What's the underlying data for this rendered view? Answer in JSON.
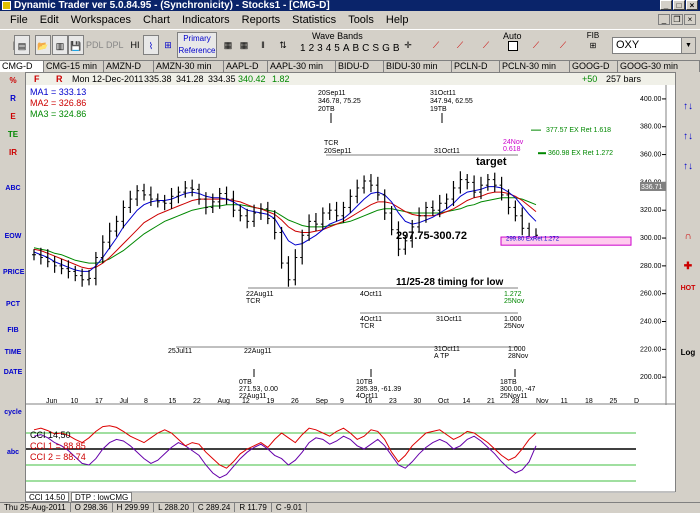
{
  "window": {
    "title": "Dynamic Trader ver 5.0.84.95 - (Synchronicity) - Stocks1 - [CMG-D]",
    "controls": [
      "_",
      "□",
      "×"
    ]
  },
  "menu": [
    "File",
    "Edit",
    "Workspaces",
    "Chart",
    "Indicators",
    "Reports",
    "Statistics",
    "Tools",
    "Help"
  ],
  "toolbar": {
    "buttons": [
      "PDL",
      "DPL",
      "HI"
    ],
    "primary_reference": [
      "Primary",
      "Reference"
    ],
    "wave_bands_label": "Wave Bands",
    "wave_bands": [
      "1",
      "2",
      "3",
      "4",
      "5",
      "A",
      "B",
      "C",
      "S",
      "G",
      "B"
    ],
    "auto_label": "Auto",
    "fib_label": "FIB",
    "symbol": "OXY"
  },
  "tabs": [
    "CMG-D",
    "CMG-15 min",
    "AMZN-D",
    "AMZN-30 min",
    "AAPL-D",
    "AAPL-30 min",
    "BIDU-D",
    "BIDU-30 min",
    "PCLN-D",
    "PCLN-30 min",
    "GOOG-D",
    "GOOG-30 min"
  ],
  "infobar": {
    "f": "F",
    "r": "R",
    "date": "Mon 12-Dec-2011",
    "open": "335.38",
    "high": "341.28",
    "low": "334.35",
    "close": "340.42",
    "change": "1.82",
    "bars_change": "+50",
    "bars": "257 bars"
  },
  "moving_averages": [
    {
      "label": "MA1 = 333.13",
      "color": "#0000cc"
    },
    {
      "label": "MA2 = 326.86",
      "color": "#cc0000"
    },
    {
      "label": "MA3 = 324.86",
      "color": "#008800"
    }
  ],
  "cci": [
    {
      "label": "CCI 14,50",
      "color": "#000000"
    },
    {
      "label": "CCI 1 = 88.85",
      "color": "#cc0000"
    },
    {
      "label": "CCI 2 = 88.74",
      "color": "#cc0000"
    }
  ],
  "chart_data": {
    "type": "line",
    "series_type": "ohlc-bars",
    "ylim": [
      180,
      410
    ],
    "yticks": [
      200,
      220,
      240,
      260,
      280,
      300,
      320,
      340,
      360,
      380,
      400
    ],
    "xticks": [
      "Jun",
      "10",
      "17",
      "Jul",
      "8",
      "15",
      "22",
      "Aug",
      "12",
      "19",
      "26",
      "Sep",
      "9",
      "16",
      "23",
      "30",
      "Oct",
      "14",
      "21",
      "28",
      "Nov",
      "11",
      "18",
      "25",
      "D"
    ],
    "closes": [
      288,
      286,
      283,
      280,
      278,
      276,
      273,
      270,
      271,
      286,
      297,
      305,
      312,
      322,
      328,
      334,
      331,
      328,
      326,
      325,
      330,
      333,
      336,
      335,
      328,
      322,
      326,
      332,
      328,
      320,
      316,
      312,
      318,
      321,
      314,
      304,
      282,
      270,
      286,
      302,
      312,
      310,
      318,
      320,
      316,
      322,
      330,
      336,
      341,
      338,
      331,
      318,
      306,
      292,
      298,
      308,
      316,
      322,
      320,
      325,
      328,
      336,
      342,
      340,
      333,
      338,
      342,
      338,
      331,
      322,
      316,
      307,
      300,
      302
    ],
    "ma1": [
      290,
      288,
      286,
      283,
      281,
      279,
      277,
      276,
      276,
      280,
      286,
      293,
      300,
      308,
      314,
      320,
      324,
      326,
      327,
      327,
      328,
      330,
      332,
      333,
      332,
      330,
      329,
      329,
      328,
      326,
      323,
      320,
      319,
      318,
      317,
      314,
      306,
      298,
      295,
      296,
      299,
      302,
      306,
      310,
      312,
      314,
      318,
      323,
      328,
      332,
      333,
      331,
      326,
      318,
      312,
      310,
      311,
      313,
      315,
      318,
      321,
      325,
      330,
      333,
      334,
      335,
      337,
      337,
      336,
      333,
      329,
      323,
      317,
      312
    ],
    "ma2": [
      292,
      291,
      289,
      287,
      285,
      283,
      281,
      279,
      278,
      279,
      282,
      286,
      291,
      296,
      301,
      306,
      311,
      314,
      317,
      319,
      321,
      323,
      325,
      327,
      328,
      328,
      328,
      328,
      328,
      327,
      326,
      324,
      322,
      321,
      319,
      317,
      313,
      308,
      305,
      304,
      304,
      305,
      306,
      308,
      310,
      312,
      315,
      318,
      321,
      324,
      326,
      326,
      325,
      322,
      319,
      317,
      316,
      316,
      316,
      317,
      319,
      321,
      324,
      327,
      329,
      330,
      332,
      333,
      333,
      332,
      330,
      327,
      323,
      319
    ],
    "ma3": [
      293,
      292,
      291,
      289,
      288,
      286,
      284,
      283,
      282,
      282,
      283,
      285,
      288,
      291,
      295,
      299,
      303,
      306,
      309,
      312,
      314,
      316,
      318,
      320,
      321,
      322,
      323,
      323,
      324,
      324,
      324,
      323,
      322,
      321,
      320,
      319,
      316,
      313,
      311,
      309,
      308,
      308,
      308,
      309,
      310,
      311,
      312,
      314,
      316,
      318,
      320,
      321,
      321,
      320,
      319,
      318,
      318,
      318,
      318,
      318,
      319,
      320,
      321,
      323,
      324,
      326,
      327,
      328,
      329,
      329,
      329,
      328,
      326,
      324
    ],
    "cci_red": [
      120,
      130,
      115,
      95,
      100,
      85,
      60,
      40,
      70,
      110,
      140,
      145,
      135,
      110,
      80,
      60,
      40,
      70,
      100,
      120,
      100,
      60,
      20,
      40,
      30,
      -20,
      -60,
      -100,
      -120,
      -80,
      -30,
      0,
      20,
      40,
      10,
      60,
      100,
      70,
      40,
      90,
      130,
      120,
      100,
      80,
      110,
      130,
      100,
      60,
      80,
      120,
      110,
      60,
      -20,
      -80,
      -40,
      20,
      60,
      100,
      110,
      120,
      90,
      60,
      80,
      110,
      100,
      70,
      40,
      0,
      -40,
      -70,
      -50,
      0,
      60,
      100
    ],
    "cci_purple": [
      80,
      90,
      70,
      40,
      20,
      -10,
      -50,
      -90,
      -100,
      -60,
      0,
      40,
      60,
      50,
      20,
      -20,
      -60,
      -90,
      -70,
      -30,
      10,
      40,
      20,
      -10,
      -40,
      -100,
      -150,
      -180,
      -160,
      -110,
      -60,
      -20,
      10,
      30,
      0,
      -40,
      -60,
      -100,
      -70,
      -20,
      40,
      70,
      60,
      30,
      50,
      80,
      60,
      20,
      0,
      30,
      60,
      20,
      -40,
      -100,
      -120,
      -80,
      -30,
      10,
      40,
      60,
      40,
      0,
      20,
      60,
      80,
      50,
      10,
      -30,
      -80,
      -120,
      -150,
      -130,
      -80,
      20
    ]
  },
  "annotations": {
    "top_labels": [
      "20Sep11",
      "346.78, 75.25",
      "20TB",
      "31Oct11",
      "347.94, 62.55",
      "19TB"
    ],
    "tcr_top": "TCR",
    "tcr_top_date": "20Sep11",
    "oct31_mid": "31Oct11",
    "target": "target",
    "ex_ret_1": "377.57 EX Ret 1.618",
    "ex_ret_2": "360.98 EX Ret 1.272",
    "nov24_date": "24Nov",
    "nov24_val": "0.618",
    "zone": "297.75-300.72",
    "zone_small": "299.80 ExRet 1.272",
    "timing": "11/25-28 timing for low",
    "aug22_1": "22Aug11",
    "aug22_tcr": "TCR",
    "oct4_1": "4Oct11",
    "ratio_1272": "1.272",
    "nov25_1": "25Nov",
    "oct4_2": "4Oct11",
    "tcr_2": "TCR",
    "oct31_2": "31Oct11",
    "ratio_1000": "1.000",
    "nov25_2": "25Nov",
    "jul25": "25Jul11",
    "aug22_2": "22Aug11",
    "oct31_3": "31Oct11",
    "atp": "A TP",
    "ratio_1000b": "1.000",
    "nov28": "28Nov",
    "bottom_a": [
      "0TB",
      "271.53, 0.00",
      "22Aug11"
    ],
    "bottom_b": [
      "10TB",
      "285.39, -61.39",
      "4Oct11"
    ],
    "bottom_c": [
      "18TB",
      "300.00, -47",
      "25Nov11"
    ],
    "price_tag": "336.71"
  },
  "leftbar": [
    "%",
    "R",
    "E",
    "TE",
    "IR",
    "ABC",
    "EOW",
    "PRICE",
    "PCT",
    "FIB",
    "TIME",
    "DATE",
    "cycle",
    "abc"
  ],
  "rightbar": [
    "↑↓",
    "↑↓",
    "↑↓",
    "✚",
    "HOT",
    "Log"
  ],
  "bottom_tabs": [
    "CCI 14.50",
    "DTP : lowCMG"
  ],
  "status": [
    "Thu 25-Aug-2011",
    "O 298.36",
    "H 299.99",
    "L 288.20",
    "C 289.24",
    "R 11.79",
    "C -9.01"
  ]
}
